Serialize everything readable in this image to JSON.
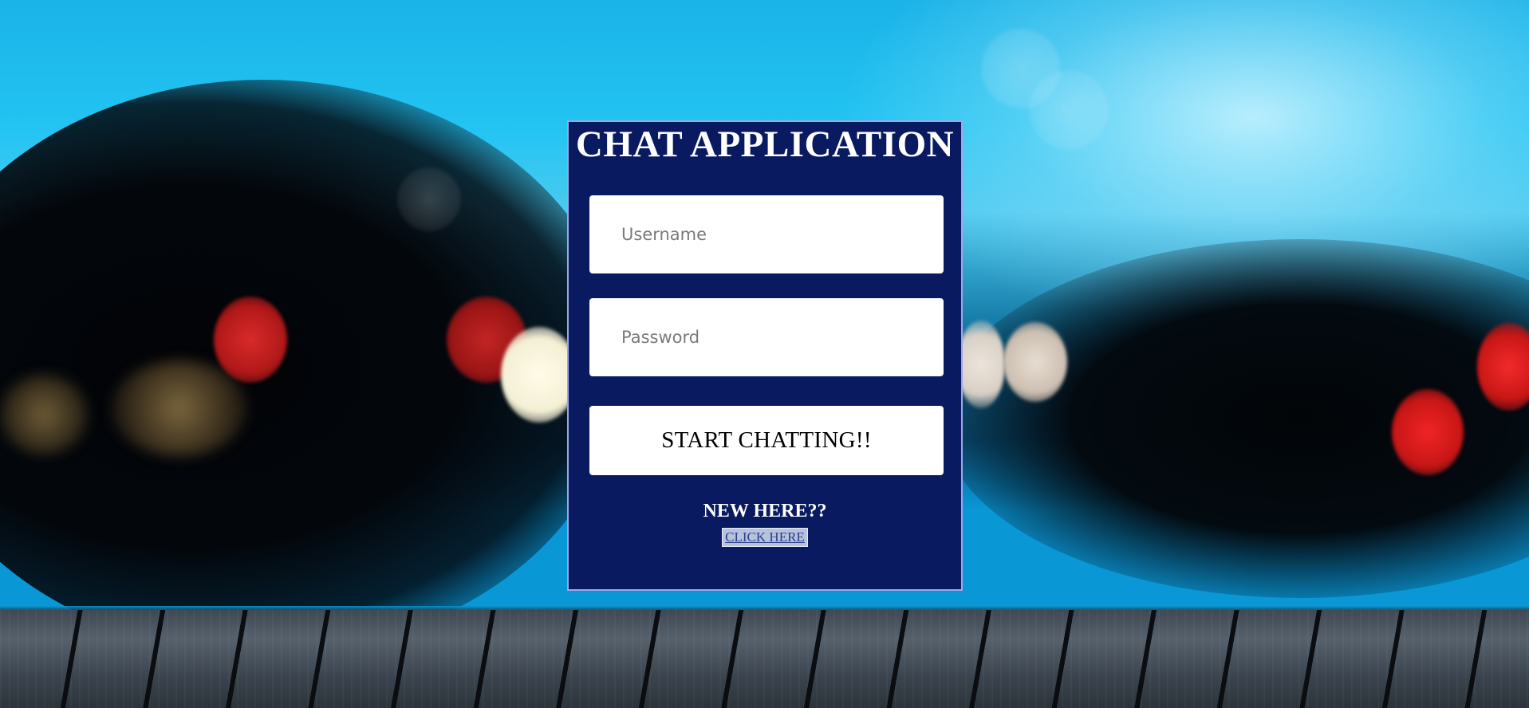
{
  "app": {
    "title": "CHAT APPLICATION"
  },
  "form": {
    "username_placeholder": "Username",
    "username_value": "",
    "password_placeholder": "Password",
    "password_value": "",
    "submit_label": "START CHATTING!!"
  },
  "signup": {
    "prompt": "NEW HERE??",
    "link_label": "CLICK HERE"
  },
  "colors": {
    "panel_background": "#091a60",
    "panel_border": "#9da7e8",
    "title_text": "#ffffff",
    "link_text": "#2a3d8f",
    "link_background": "#b7c2dc"
  }
}
